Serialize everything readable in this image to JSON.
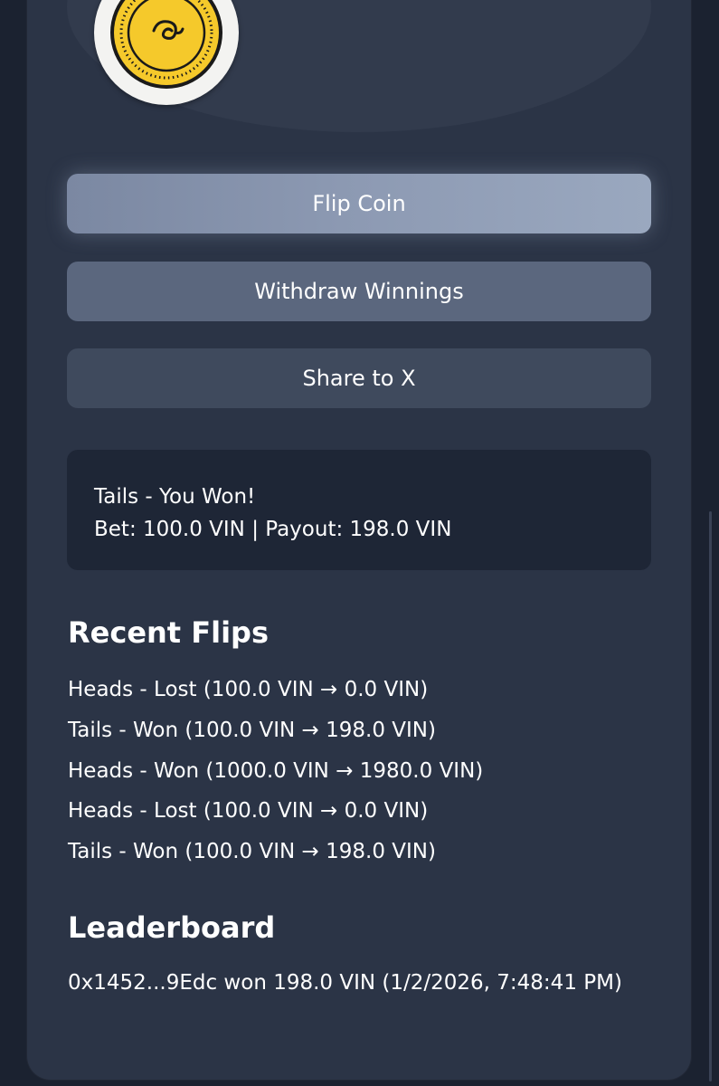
{
  "buttons": {
    "flip": "Flip Coin",
    "withdraw": "Withdraw Winnings",
    "share": "Share to X"
  },
  "result": {
    "line1": "Tails - You Won!",
    "line2": "Bet: 100.0 VIN | Payout: 198.0 VIN"
  },
  "recent_flips": {
    "title": "Recent Flips",
    "items": [
      "Heads - Lost (100.0 VIN → 0.0 VIN)",
      "Tails - Won (100.0 VIN → 198.0 VIN)",
      "Heads - Won (1000.0 VIN → 1980.0 VIN)",
      "Heads - Lost (100.0 VIN → 0.0 VIN)",
      "Tails - Won (100.0 VIN → 198.0 VIN)"
    ]
  },
  "leaderboard": {
    "title": "Leaderboard",
    "entries": [
      "0x1452...9Edc won 198.0 VIN (1/2/2026, 7:48:41 PM)"
    ]
  },
  "colors": {
    "background": "#1b2230",
    "card": "#2b3446",
    "coin_gold": "#f5c92b",
    "accent_button": "#8d9ab3"
  }
}
